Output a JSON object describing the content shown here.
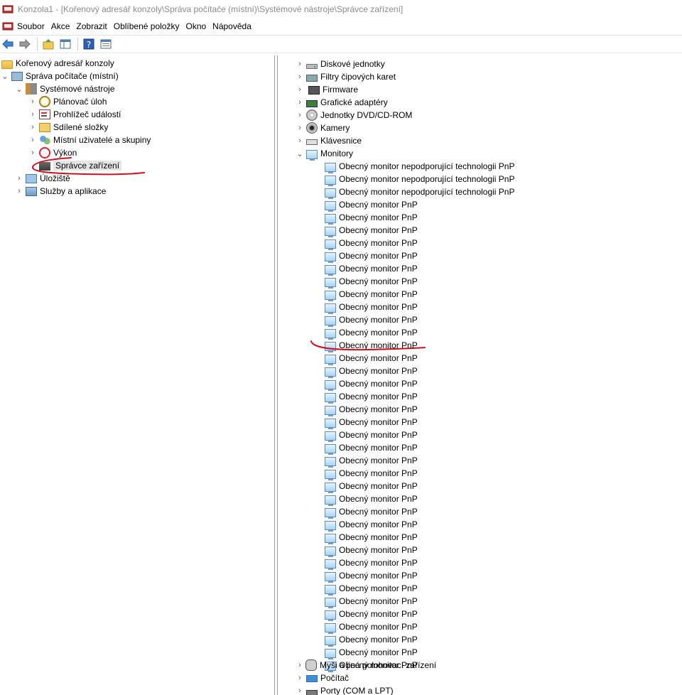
{
  "window": {
    "title": "Konzola1 - [Kořenový adresář konzoly\\Správa počítače (místní)\\Systémové nástroje\\Správce zařízení]"
  },
  "menu": [
    "Soubor",
    "Akce",
    "Zobrazit",
    "Oblíbené položky",
    "Okno",
    "Nápověda"
  ],
  "toolbar": {
    "buttons": [
      "back-arrow-icon",
      "forward-arrow-icon",
      "up-folder-icon",
      "show-hide-tree-icon",
      "help-icon",
      "properties-icon"
    ]
  },
  "left_tree": [
    {
      "label": "Kořenový adresář konzoly",
      "icon": "folder-icon",
      "level": 0
    },
    {
      "label": "Správa počítače (místní)",
      "icon": "computer-management-icon",
      "level": 1,
      "expanded": true
    },
    {
      "label": "Systémové nástroje",
      "icon": "tools-icon",
      "level": 2,
      "expanded": true
    },
    {
      "label": "Plánovač úloh",
      "icon": "clock-icon",
      "level": 3
    },
    {
      "label": "Prohlížeč událostí",
      "icon": "event-viewer-icon",
      "level": 3
    },
    {
      "label": "Sdílené složky",
      "icon": "shared-folder-icon",
      "level": 3
    },
    {
      "label": "Místní uživatelé a skupiny",
      "icon": "users-icon",
      "level": 3
    },
    {
      "label": "Výkon",
      "icon": "performance-icon",
      "level": 3
    },
    {
      "label": "Správce zařízení",
      "icon": "device-manager-icon",
      "level": 3,
      "selected": true
    },
    {
      "label": "Úložiště",
      "icon": "storage-icon",
      "level": 2
    },
    {
      "label": "Služby a aplikace",
      "icon": "services-icon",
      "level": 2
    }
  ],
  "device_tree": {
    "categories_before": [
      {
        "label": "Diskové jednotky",
        "icon": "disk-icon"
      },
      {
        "label": "Filtry čipových karet",
        "icon": "smartcard-icon"
      },
      {
        "label": "Firmware",
        "icon": "chip-icon"
      },
      {
        "label": "Grafické adaptéry",
        "icon": "gpu-icon"
      },
      {
        "label": "Jednotky DVD/CD-ROM",
        "icon": "dvd-icon"
      },
      {
        "label": "Kamery",
        "icon": "camera-icon"
      },
      {
        "label": "Klávesnice",
        "icon": "keyboard-icon"
      }
    ],
    "monitors": {
      "label": "Monitory",
      "icon": "monitor-icon",
      "children": [
        "Obecný monitor nepodporující technologii PnP",
        "Obecný monitor nepodporující technologii PnP",
        "Obecný monitor nepodporující technologii PnP",
        "Obecný monitor PnP",
        "Obecný monitor PnP",
        "Obecný monitor PnP",
        "Obecný monitor PnP",
        "Obecný monitor PnP",
        "Obecný monitor PnP",
        "Obecný monitor PnP",
        "Obecný monitor PnP",
        "Obecný monitor PnP",
        "Obecný monitor PnP",
        "Obecný monitor PnP",
        "Obecný monitor PnP",
        "Obecný monitor PnP",
        "Obecný monitor PnP",
        "Obecný monitor PnP",
        "Obecný monitor PnP",
        "Obecný monitor PnP",
        "Obecný monitor PnP",
        "Obecný monitor PnP",
        "Obecný monitor PnP",
        "Obecný monitor PnP",
        "Obecný monitor PnP",
        "Obecný monitor PnP",
        "Obecný monitor PnP",
        "Obecný monitor PnP",
        "Obecný monitor PnP",
        "Obecný monitor PnP",
        "Obecný monitor PnP",
        "Obecný monitor PnP",
        "Obecný monitor PnP",
        "Obecný monitor PnP",
        "Obecný monitor PnP",
        "Obecný monitor PnP",
        "Obecný monitor PnP",
        "Obecný monitor PnP",
        "Obecný monitor PnP",
        "Obecný monitor PnP"
      ]
    },
    "categories_after": [
      {
        "label": "Myši a jiná polohovací zařízení",
        "icon": "mouse-icon"
      },
      {
        "label": "Počítač",
        "icon": "computer-icon"
      },
      {
        "label": "Porty (COM a LPT)",
        "icon": "port-icon"
      }
    ]
  },
  "colors": {
    "annotation_red": "#d10f1f",
    "selection_gray": "#e5e5e5",
    "title_gray": "#8a8a8a"
  }
}
